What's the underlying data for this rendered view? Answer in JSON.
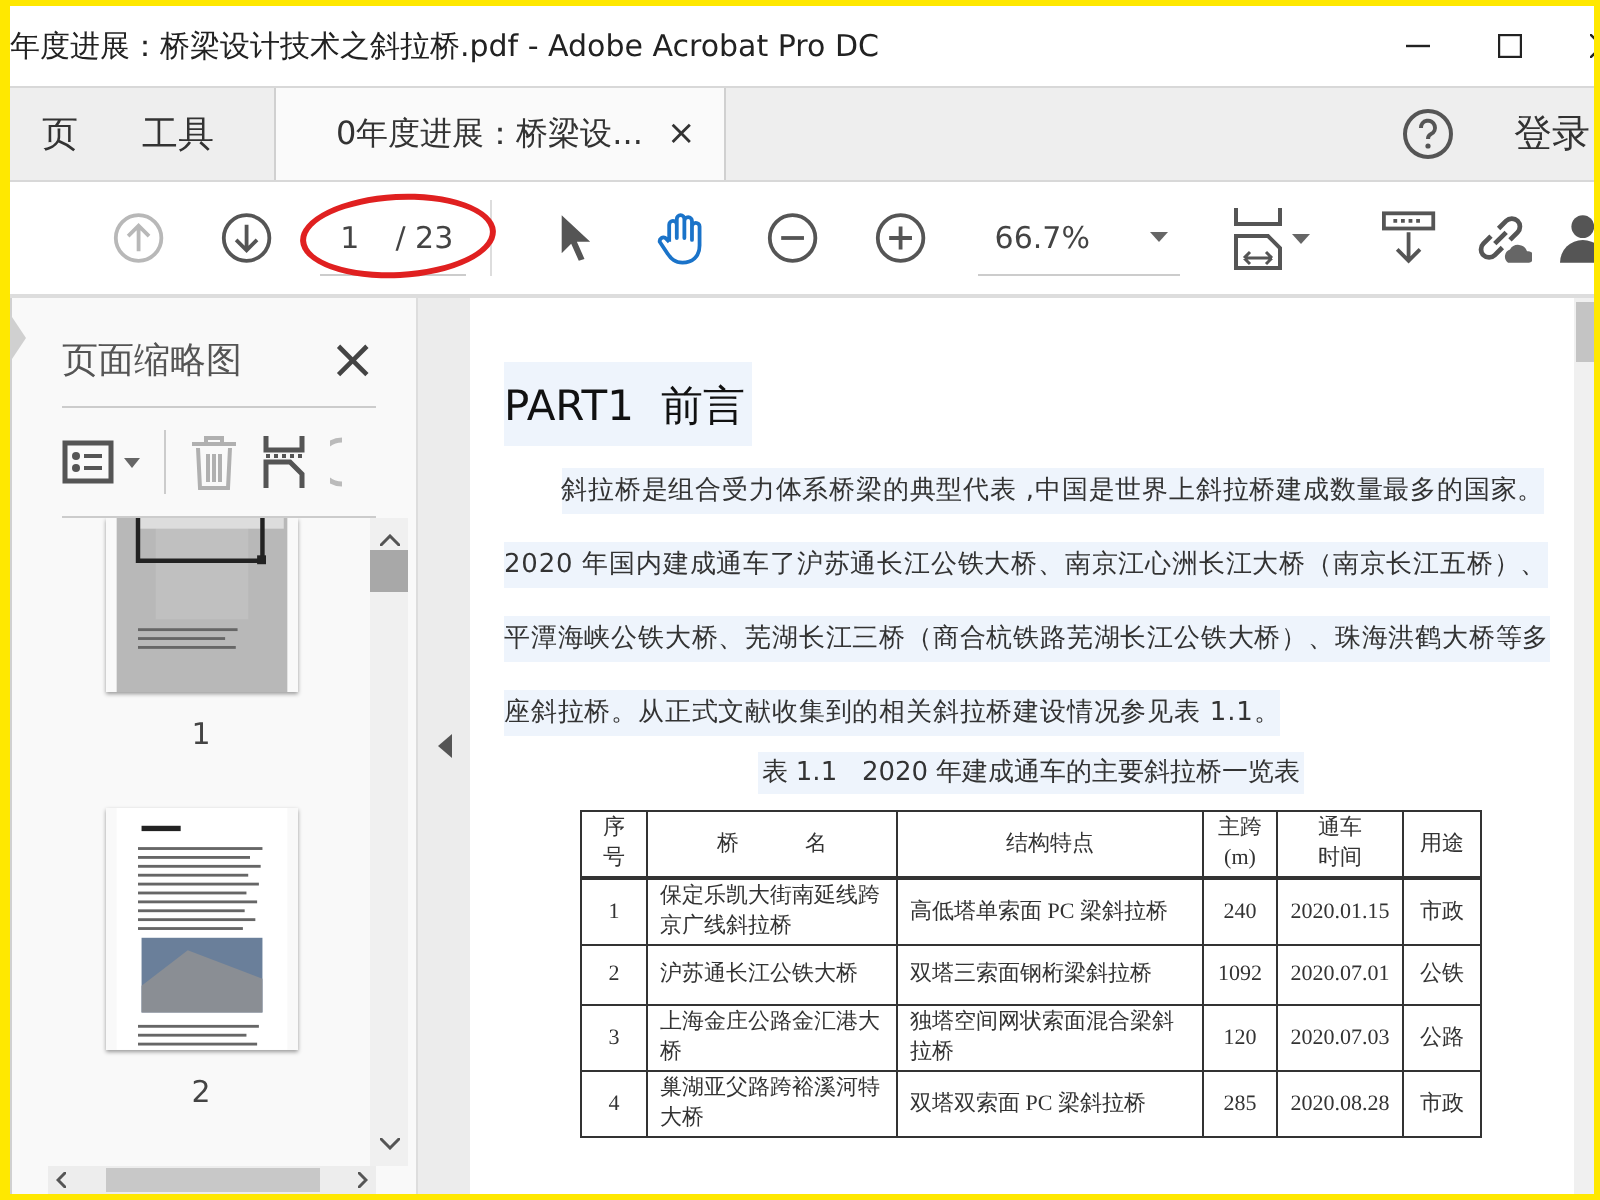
{
  "window": {
    "title": "年度进展：桥梁设计技术之斜拉桥.pdf - Adobe Acrobat Pro DC"
  },
  "tabs": [
    {
      "label": "页",
      "selected": false,
      "closable": false
    },
    {
      "label": "工具",
      "selected": false,
      "closable": false
    },
    {
      "label": "0年度进展：桥梁设...",
      "selected": true,
      "closable": true,
      "close_glyph": "×"
    }
  ],
  "account": {
    "sign_in": "登录"
  },
  "toolbar": {
    "prev_page_disabled": true,
    "page": "1",
    "page_count": "/ 23",
    "tools": [
      {
        "kind": "select",
        "selected": false
      },
      {
        "kind": "hand",
        "selected": true
      }
    ],
    "zoom": "66.7%"
  },
  "sidebar": {
    "title": "页面缩略图",
    "close_glyph": "×",
    "delete_disabled": true,
    "thumbnails": [
      {
        "label": "1",
        "selected": true
      },
      {
        "label": "2",
        "selected": false
      }
    ]
  },
  "document": {
    "heading": "PART1  前言",
    "paragraph": "斜拉桥是组合受力体系桥梁的典型代表 ,中国是世界上斜拉桥建成数量最多的国家。2020 年国内建成通车了沪苏通长江公铁大桥、南京江心洲长江大桥（南京长江五桥）、平潭海峡公铁大桥、芜湖长江三桥（商合杭铁路芜湖长江公铁大桥）、珠海洪鹤大桥等多座斜拉桥。从正式文献收集到的相关斜拉桥建设情况参见表 1.1。",
    "table_caption": "表 1.1   2020 年建成通车的主要斜拉桥一览表",
    "table": {
      "columns": [
        "序号",
        "桥　　　名",
        "结构特点",
        "主跨(m)",
        "通车时间",
        "用途"
      ],
      "rows": [
        [
          "1",
          "保定乐凯大街南延线跨京广线斜拉桥",
          "高低塔单索面 PC 梁斜拉桥",
          "240",
          "2020.01.15",
          "市政"
        ],
        [
          "2",
          "沪苏通长江公铁大桥",
          "双塔三索面钢桁梁斜拉桥",
          "1092",
          "2020.07.01",
          "公铁"
        ],
        [
          "3",
          "上海金庄公路金汇港大桥",
          "独塔空间网状索面混合梁斜拉桥",
          "120",
          "2020.07.03",
          "公路"
        ],
        [
          "4",
          "巢湖亚父路跨裕溪河特大桥",
          "双塔双索面 PC 梁斜拉桥",
          "285",
          "2020.08.28",
          "市政"
        ]
      ]
    }
  }
}
